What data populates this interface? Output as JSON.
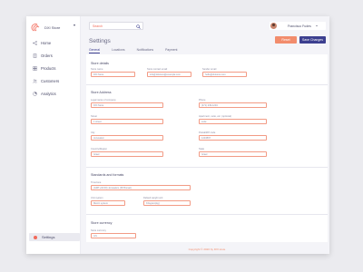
{
  "brand": {
    "name": "DXI Store"
  },
  "nav": {
    "items": [
      {
        "label": "Home",
        "icon": "share-icon"
      },
      {
        "label": "Orders",
        "icon": "receipt-icon"
      },
      {
        "label": "Products",
        "icon": "grid-icon"
      },
      {
        "label": "Customers",
        "icon": "people-icon"
      },
      {
        "label": "Analytics",
        "icon": "chart-icon"
      }
    ]
  },
  "settings_nav": {
    "label": "Settings"
  },
  "search": {
    "placeholder": "Search"
  },
  "user": {
    "name": "Francisco Fudes"
  },
  "page": {
    "title": "Settings"
  },
  "actions": {
    "reset": "Reset",
    "save": "Save Changes"
  },
  "tabs": [
    "General",
    "Locations",
    "Notifications",
    "Payment"
  ],
  "sections": {
    "details": {
      "title": "Store details",
      "store_name_label": "Store name",
      "store_name_value": "DXI Store",
      "account_email_label": "Store contact email",
      "account_email_value": "info@dxistore@example.com",
      "sender_email_label": "Sender email",
      "sender_email_value": "hello@dxistore.com"
    },
    "address": {
      "title": "Store Address",
      "legal_label": "Legal name of company",
      "legal_value": "DXI Store",
      "phone_label": "Phone",
      "phone_value": "(471) 239-1234",
      "street_label": "Street",
      "street_value": "1 street",
      "apartment_label": "Apartment, suite, etc. (optional)",
      "apartment_value": "suite",
      "city_label": "City",
      "city_value": "Jerusalem",
      "zip_label": "Postal/ZIP code",
      "zip_value": "1234567",
      "country_label": "Country/Region",
      "country_value": "Israel",
      "state_label": "State",
      "state_value": "Israel"
    },
    "standards": {
      "title": "Standards and formats",
      "timezone_label": "Timezone",
      "timezone_value": "(GMT+02:00) Jerusalem (IST/Israel)",
      "unit_label": "Unit system",
      "unit_value": "Metric system",
      "weight_label": "Default weight unit",
      "weight_value": "Kilogram(kg)"
    },
    "currency": {
      "title": "Store currency",
      "currency_label": "Store currency",
      "currency_value": "ILS"
    }
  },
  "footer": {
    "text": "Copyright © 2020 by DXI store"
  },
  "colors": {
    "accent": "#f28c6c",
    "primary": "#3c3f8f",
    "field_border": "#f29b85"
  }
}
